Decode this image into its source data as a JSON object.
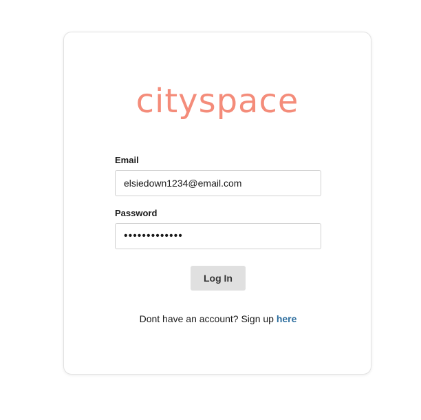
{
  "brand": {
    "logo_text": "cityspace",
    "logo_color": "#f48c7a"
  },
  "login_form": {
    "email_label": "Email",
    "email_value": "elsiedown1234@email.com",
    "password_label": "Password",
    "password_value": "•••••••••••••",
    "submit_label": "Log In",
    "submit_bg": "#e0e0e0"
  },
  "signup": {
    "prompt_text": "Dont have an account? Sign up ",
    "link_text": "here",
    "link_color": "#2f6f9f"
  }
}
